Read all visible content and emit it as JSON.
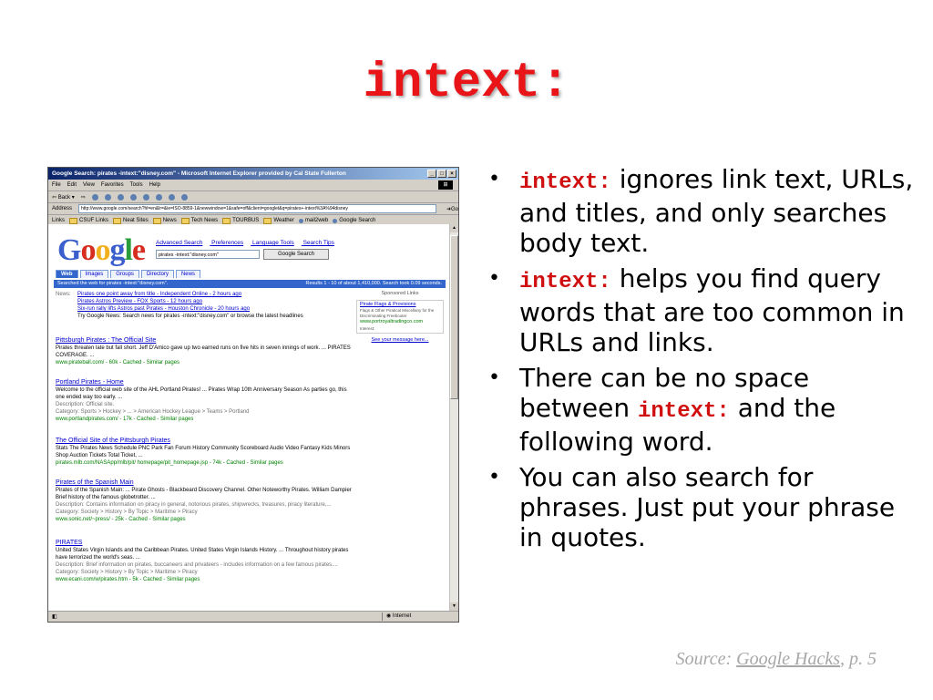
{
  "slide": {
    "title": "intext:",
    "bullets": [
      {
        "code": "intext:",
        "text": " ignores link text, URLs, and titles, and only searches body text."
      },
      {
        "code": "intext:",
        "text": " helps you find query words that are too common in URLs and links."
      },
      {
        "pre": "There can be no space between ",
        "code": "intext:",
        "post": " and the following word."
      },
      {
        "text": "You can also search for phrases.  Just put your phrase in quotes."
      }
    ],
    "source": {
      "prefix": "Source: ",
      "book": "Google Hacks",
      "suffix": ", p. 5"
    }
  },
  "browser": {
    "title": "Google Search: pirates -intext:\"disney.com\" - Microsoft Internet Explorer provided by Cal State Fullerton",
    "menu": [
      "File",
      "Edit",
      "View",
      "Favorites",
      "Tools",
      "Help"
    ],
    "back_label": "Back",
    "address_label": "Address",
    "address": "http://www.google.com/search?hl=en&lr=&ie=ISO-8859-1&newwindow=1&safe=off&client=googlet&q=pirates+-intext%3A%94disney",
    "go_label": "Go",
    "links_label": "Links",
    "links": [
      "CSUF Links",
      "Neat Sites",
      "News",
      "Tech News",
      "TOURBUS",
      "Weather",
      "mail2web",
      "Google Search"
    ],
    "status": "Internet",
    "window_buttons": [
      "_",
      "□",
      "×"
    ]
  },
  "google": {
    "logo": "Google",
    "logo_letters": [
      {
        "c": "G",
        "color": "#3a5fcd"
      },
      {
        "c": "o",
        "color": "#d62d20"
      },
      {
        "c": "o",
        "color": "#f2b01e"
      },
      {
        "c": "g",
        "color": "#3a5fcd"
      },
      {
        "c": "l",
        "color": "#2a9d3a"
      },
      {
        "c": "e",
        "color": "#d62d20"
      }
    ],
    "top_links": [
      "Advanced Search",
      "Preferences",
      "Language Tools",
      "Search Tips"
    ],
    "query": "pirates -intext:\"disney.com\"",
    "search_button": "Google Search",
    "tabs": [
      "Web",
      "Images",
      "Groups",
      "Directory",
      "News"
    ],
    "searched_for": "Searched the web for pirates -intext:\"disney.com\".",
    "results_count": "Results 1 - 10 of about 1,410,000. Search took 0.09 seconds.",
    "news": {
      "label": "News:",
      "items": [
        "Pirates one point away from title - Independent Online - 2 hours ago",
        "Pirates Astros Preview - FOX Sports - 12 hours ago",
        "Six-run rally lifts Astros past Pirates - Houston Chronicle - 20 hours ago",
        "Try Google News: Search news for pirates -intext:\"disney.com\" or browse the latest headlines"
      ]
    },
    "sponsored": {
      "label": "Sponsored Links",
      "ad_title": "Pirate Flags & Provisions",
      "ad_text": "Flags & Other Piratical Miscellany for the Discriminating Freebooter",
      "ad_url": "www.portroyaltradingco.com",
      "ad_tag": "Interest:",
      "see_message": "See your message here..."
    },
    "results": [
      {
        "title": "Pittsburgh Pirates : The Official Site",
        "snippet": "Pirates threaten late but fall short. Jeff D'Amico gave up two earned runs on five hits in seven innings of work. ... PIRATES COVERAGE. ...",
        "url": "www.pirateball.com/ - 60k - Cached - Similar pages"
      },
      {
        "title": "Portland Pirates - Home",
        "snippet": "Welcome to the official web site of the AHL Portland Pirates! ... Pirates Wrap 10th Anniversary Season As parties go, this one ended way too early. ...",
        "desc": "Description: Official site.",
        "cat": "Category: Sports > Hockey > ... > American Hockey League > Teams > Portland",
        "url": "www.portlandpirates.com/ - 17k - Cached - Similar pages"
      },
      {
        "title": "The Official Site of the Pittsburgh Pirates",
        "snippet": "Stats The Pirates News Schedule PNC Park Fan Forum History Community Scoreboard Audio Video Fantasy Kids Minors Shop Auction Tickets Total Ticket, ...",
        "url": "pirates.mlb.com/NASApp/mlb/pit/ homepage/pit_homepage.jsp - 74k - Cached - Similar pages"
      },
      {
        "title": "Pirates of the Spanish Main",
        "snippet": "Pirates of the Spanish Main: ... Pirate Ghosts - Blackbeard Discovery Channel. Other Noteworthy Pirates. William Dampier Brief history of the famous globetrotter. ...",
        "desc": "Description: Contains information on piracy in general, notorious pirates, shipwrecks, treasures, piracy literature,...",
        "cat": "Category: Society > History > By Topic > Maritime > Piracy",
        "url": "www.sonic.net/~press/ - 25k - Cached - Similar pages"
      },
      {
        "title": "PIRATES",
        "snippet": "United States Virgin Islands and the Caribbean Pirates. United States Virgin Islands History. ... Throughout history pirates have terrorized the world's seas. ...",
        "desc": "Description: Brief information on pirates, buccaneers and privateers - includes information on a few famous pirates....",
        "cat": "Category: Society > History > By Topic > Maritime > Piracy",
        "url": "www.ecani.com/w/pirates.htm - 5k - Cached - Similar pages"
      }
    ]
  }
}
